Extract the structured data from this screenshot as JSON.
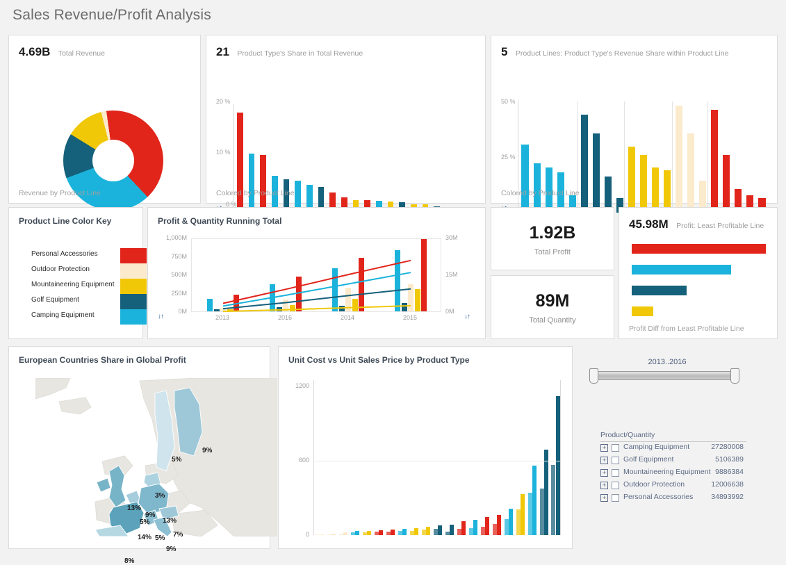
{
  "dashboard": {
    "title": "Sales Revenue/Profit Analysis",
    "background": "#f2f2f2"
  },
  "colors": {
    "red": "#e1251b",
    "cyan": "#1bb3db",
    "teal": "#15607a",
    "yellow": "#f0c808",
    "cream": "#fbeacb",
    "gold_light": "#f5d623",
    "cyan_light": "#35c3e8",
    "teal_light": "#1d7a99",
    "red_light": "#ef3e33"
  },
  "revenue_panel": {
    "kpi_value": "4.69B",
    "kpi_label": "Total Revenue",
    "caption": "Revenue by Product Line"
  },
  "share_panel": {
    "kpi_value": "21",
    "kpi_label": "Product Type's Share in Total Revenue",
    "caption": "Colored by Product Line"
  },
  "lines_panel": {
    "kpi_value": "5",
    "kpi_label": "Product Lines: Product Type's Revenue Share within Product Line",
    "caption": "Colored by Product Line"
  },
  "color_key": {
    "title": "Product Line Color Key",
    "items": [
      {
        "label": "Personal Accessories",
        "color": "#e1251b"
      },
      {
        "label": "Outdoor Protection",
        "color": "#fbeacb"
      },
      {
        "label": "Mountaineering Equipment",
        "color": "#f0c808"
      },
      {
        "label": "Golf Equipment",
        "color": "#15607a"
      },
      {
        "label": "Camping Equipment",
        "color": "#1bb3db"
      }
    ]
  },
  "running_total": {
    "title": "Profit & Quantity Running Total",
    "left_ticks": [
      "1,000M",
      "750M",
      "500M",
      "250M",
      "0M"
    ],
    "right_ticks": [
      "30M",
      "15M",
      "0M"
    ],
    "x_ticks": [
      "2013",
      "2016",
      "2014",
      "2015"
    ],
    "sort_icon_left": "↓↑",
    "sort_icon_right": "↓↑"
  },
  "profit_kpi": {
    "value": "1.92B",
    "label": "Total Profit"
  },
  "quantity_kpi": {
    "value": "89M",
    "label": "Total Quantity"
  },
  "profit_diff": {
    "kpi_value": "45.98M",
    "kpi_label": "Profit: Least Profitable Line",
    "caption": "Profit Diff from Least Profitable Line"
  },
  "map_panel": {
    "title": "European Countries Share in Global Profit"
  },
  "unitcost_panel": {
    "title": "Unit Cost vs Unit Sales Price by Product Type",
    "y_ticks": [
      "1200",
      "600",
      "0"
    ]
  },
  "filter_rail": {
    "slider_value": "2013..2016",
    "tree_header": "Product/Quantity",
    "expand_glyph": "+",
    "rows": [
      {
        "label": "Camping Equipment",
        "value": "27280008"
      },
      {
        "label": "Golf Equipment",
        "value": "5106389"
      },
      {
        "label": "Mountaineering Equipment",
        "value": "9886384"
      },
      {
        "label": "Outdoor Protection",
        "value": "12006638"
      },
      {
        "label": "Personal Accessories",
        "value": "34893992"
      }
    ]
  },
  "chart_data": [
    {
      "id": "revenue_by_product_line",
      "type": "pie",
      "title": "Revenue by Product Line",
      "labels": [
        "Personal Accessories",
        "Camping Equipment",
        "Golf Equipment",
        "Mountaineering Equipment",
        "Outdoor Protection"
      ],
      "values": [
        36,
        28,
        13,
        11,
        1.5
      ],
      "colors": [
        "#e1251b",
        "#1bb3db",
        "#15607a",
        "#f0c808",
        "#fbeacb"
      ],
      "donut": true
    },
    {
      "id": "product_type_share",
      "type": "bar",
      "title": "Product Type's Share in Total Revenue",
      "ylabel": "%",
      "ylim": [
        0,
        21
      ],
      "y_ticks": [
        "20 %",
        "10 %",
        "0 %"
      ],
      "values": [
        19.5,
        11.5,
        11.3,
        7.2,
        6.5,
        6.3,
        5.4,
        5.0,
        3.9,
        3.0,
        2.5,
        2.4,
        2.3,
        2.2,
        2.1,
        1.7,
        1.6,
        1.2,
        0.8,
        0.6,
        0.35
      ],
      "colors": [
        "#e1251b",
        "#1bb3db",
        "#e1251b",
        "#1bb3db",
        "#15607a",
        "#1bb3db",
        "#1bb3db",
        "#15607a",
        "#e1251b",
        "#e1251b",
        "#f0c808",
        "#e1251b",
        "#1bb3db",
        "#f0c808",
        "#15607a",
        "#f0c808",
        "#f0c808",
        "#15607a",
        "#fbeacb",
        "#fbeacb",
        "#fbeacb"
      ]
    },
    {
      "id": "share_within_product_line",
      "type": "bar",
      "title": "Product Lines: Product Type's Revenue Share within Product Line",
      "ylim": [
        0,
        52
      ],
      "y_ticks": [
        "50 %",
        "25 %",
        "0 %"
      ],
      "groups": [
        {
          "name": "Camping Equipment",
          "color": "#1bb3db",
          "values": [
            32,
            23,
            21,
            19,
            8
          ]
        },
        {
          "name": "Golf Equipment",
          "color": "#15607a",
          "values": [
            46,
            37,
            17,
            7
          ]
        },
        {
          "name": "Mountaineering Equipment",
          "color": "#f0c808",
          "values": [
            31,
            27,
            21,
            20
          ]
        },
        {
          "name": "Outdoor Protection",
          "color": "#fbeacb",
          "values": [
            50,
            37,
            15
          ]
        },
        {
          "name": "Personal Accessories",
          "color": "#e1251b",
          "values": [
            48,
            27,
            11,
            8,
            7
          ]
        }
      ]
    },
    {
      "id": "profit_quantity_running_total",
      "type": "bar",
      "title": "Profit & Quantity Running Total",
      "categories": [
        "2013",
        "2016",
        "2014",
        "2015"
      ],
      "ylim": [
        0,
        1100
      ],
      "ylabel": "Profit",
      "y2label": "Quantity",
      "y2lim": [
        0,
        32
      ],
      "bar_series": [
        {
          "name": "Camping Equipment",
          "color": "#1bb3db",
          "values": [
            190,
            410,
            640,
            910
          ]
        },
        {
          "name": "Golf Equipment",
          "color": "#15607a",
          "values": [
            35,
            60,
            80,
            120
          ]
        },
        {
          "name": "Outdoor Protection",
          "color": "#fbeacb",
          "values": [
            55,
            175,
            350,
            405
          ]
        },
        {
          "name": "Mountaineering Equipment",
          "color": "#f0c808",
          "values": [
            30,
            90,
            190,
            330
          ]
        },
        {
          "name": "Personal Accessories",
          "color": "#e1251b",
          "values": [
            250,
            520,
            800,
            1080
          ]
        }
      ],
      "line_series": [
        {
          "name": "Personal Accessories",
          "color": "#e1251b",
          "values": [
            140,
            350,
            570,
            780
          ]
        },
        {
          "name": "Camping Equipment",
          "color": "#1bb3db",
          "values": [
            100,
            260,
            430,
            600
          ]
        },
        {
          "name": "Golf Equipment",
          "color": "#15607a",
          "values": [
            60,
            150,
            255,
            355
          ]
        },
        {
          "name": "Mountaineering Equipment",
          "color": "#f0c808",
          "values": [
            20,
            45,
            75,
            105
          ]
        }
      ]
    },
    {
      "id": "profit_diff_from_least_profitable",
      "type": "bar",
      "orientation": "horizontal",
      "title": "Profit Diff from Least Profitable Line",
      "labels": [
        "Personal Accessories",
        "Camping Equipment",
        "Golf Equipment",
        "Mountaineering Equipment"
      ],
      "values": [
        100,
        74,
        41,
        16
      ],
      "colors": [
        "#e1251b",
        "#1bb3db",
        "#15607a",
        "#f0c808"
      ]
    },
    {
      "id": "european_profit_share",
      "type": "heatmap",
      "title": "European Countries Share in Global Profit",
      "points": [
        {
          "label": "5%",
          "x": 196,
          "y": 112
        },
        {
          "label": "9%",
          "x": 240,
          "y": 99
        },
        {
          "label": "3%",
          "x": 172,
          "y": 164
        },
        {
          "label": "13%",
          "x": 132,
          "y": 182
        },
        {
          "label": "9%",
          "x": 158,
          "y": 192
        },
        {
          "label": "5%",
          "x": 150,
          "y": 202
        },
        {
          "label": "13%",
          "x": 183,
          "y": 200
        },
        {
          "label": "14%",
          "x": 147,
          "y": 224
        },
        {
          "label": "5%",
          "x": 172,
          "y": 225
        },
        {
          "label": "7%",
          "x": 198,
          "y": 220
        },
        {
          "label": "9%",
          "x": 188,
          "y": 241
        },
        {
          "label": "8%",
          "x": 128,
          "y": 258
        }
      ]
    },
    {
      "id": "unit_cost_vs_sales_price",
      "type": "bar",
      "title": "Unit Cost vs Unit Sales Price by Product Type",
      "ylim": [
        0,
        1250
      ],
      "y_ticks": [
        "1200",
        "600",
        "0"
      ],
      "pairs": [
        {
          "color": "#fbeacb",
          "cost": 4,
          "price": 6
        },
        {
          "color": "#fbeacb",
          "cost": 7,
          "price": 10
        },
        {
          "color": "#fbeacb",
          "cost": 14,
          "price": 22
        },
        {
          "color": "#1bb3db",
          "cost": 22,
          "price": 34
        },
        {
          "color": "#f0c808",
          "cost": 20,
          "price": 32
        },
        {
          "color": "#e1251b",
          "cost": 26,
          "price": 42
        },
        {
          "color": "#e1251b",
          "cost": 28,
          "price": 45
        },
        {
          "color": "#1bb3db",
          "cost": 32,
          "price": 52
        },
        {
          "color": "#f0c808",
          "cost": 34,
          "price": 56
        },
        {
          "color": "#f0c808",
          "cost": 44,
          "price": 68
        },
        {
          "color": "#15607a",
          "cost": 48,
          "price": 78
        },
        {
          "color": "#15607a",
          "cost": 30,
          "price": 85
        },
        {
          "color": "#e1251b",
          "cost": 52,
          "price": 110
        },
        {
          "color": "#1bb3db",
          "cost": 58,
          "price": 125
        },
        {
          "color": "#e1251b",
          "cost": 70,
          "price": 145
        },
        {
          "color": "#e1251b",
          "cost": 88,
          "price": 165
        },
        {
          "color": "#1bb3db",
          "cost": 130,
          "price": 215
        },
        {
          "color": "#f0c808",
          "cost": 205,
          "price": 330
        },
        {
          "color": "#1bb3db",
          "cost": 345,
          "price": 560
        },
        {
          "color": "#15607a",
          "cost": 375,
          "price": 690
        },
        {
          "color": "#15607a",
          "cost": 565,
          "price": 1120
        }
      ]
    }
  ]
}
